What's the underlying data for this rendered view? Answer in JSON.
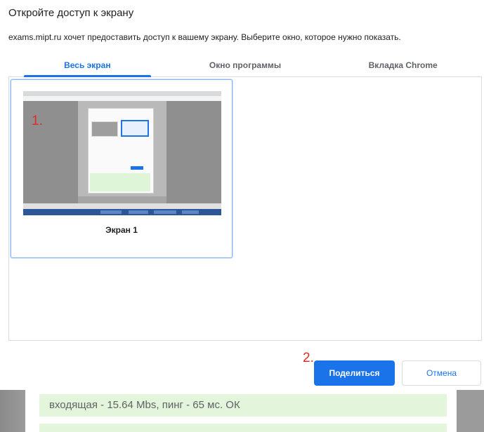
{
  "dialog": {
    "title": "Откройте доступ к экрану",
    "subtitle": "exams.mipt.ru хочет предоставить доступ к вашему экрану. Выберите окно, которое нужно показать."
  },
  "tabs": [
    {
      "label": "Весь экран",
      "active": true
    },
    {
      "label": "Окно программы",
      "active": false
    },
    {
      "label": "Вкладка Chrome",
      "active": false
    }
  ],
  "screens": [
    {
      "label": "Экран 1",
      "selected": true
    }
  ],
  "annotations": {
    "step1": "1.",
    "step2": "2."
  },
  "buttons": {
    "share": "Поделиться",
    "cancel": "Отмена"
  },
  "background": {
    "row_text": "входящая - 15.64 Mbs, пинг - 65 мс. ОК"
  },
  "colors": {
    "accent": "#1a73e8",
    "annotation": "#d93025",
    "success_bg": "#e3f5da"
  }
}
